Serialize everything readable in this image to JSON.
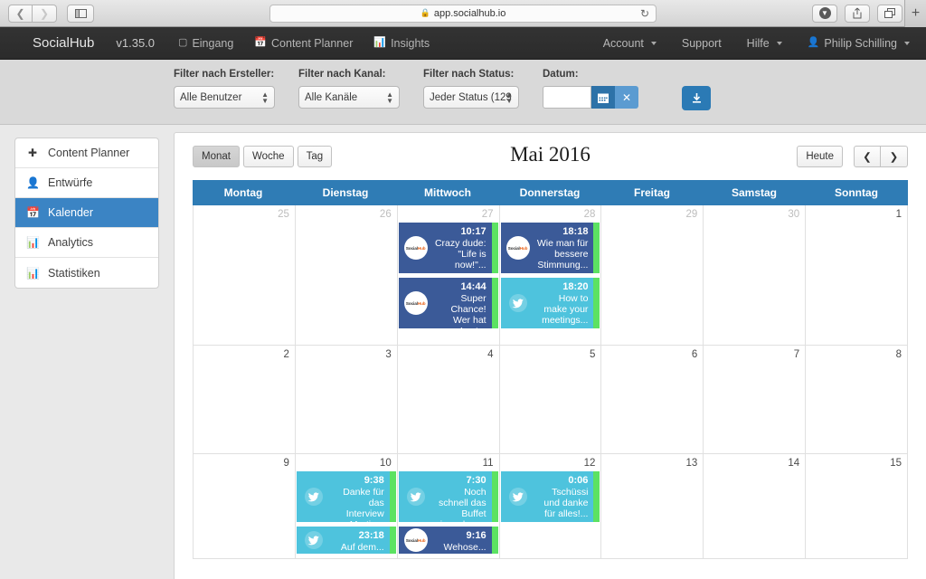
{
  "browser": {
    "url": "app.socialhub.io",
    "lock_icon": "lock-icon",
    "reload_icon": "reload-icon",
    "back_icon": "back-arrow-icon",
    "forward_icon": "forward-arrow-icon",
    "sidebar_icon": "sidebar-toggle-icon",
    "download_icon": "download-icon",
    "share_icon": "share-icon",
    "tabs_icon": "tabs-icon",
    "newtab_icon": "plus-icon"
  },
  "navbar": {
    "brand": "SocialHub",
    "version": "v1.35.0",
    "links": [
      {
        "label": "Eingang",
        "icon": "inbox-icon"
      },
      {
        "label": "Content Planner",
        "icon": "calendar-icon"
      },
      {
        "label": "Insights",
        "icon": "bar-chart-icon"
      }
    ],
    "right": [
      {
        "label": "Account",
        "caret": true
      },
      {
        "label": "Support",
        "caret": false
      },
      {
        "label": "Hilfe",
        "caret": true
      },
      {
        "label": "Philip Schilling",
        "caret": true,
        "icon": "user-icon"
      }
    ]
  },
  "filters": {
    "creator": {
      "label": "Filter nach Ersteller:",
      "value": "Alle Benutzer"
    },
    "channel": {
      "label": "Filter nach Kanal:",
      "value": "Alle Kanäle"
    },
    "status": {
      "label": "Filter nach Status:",
      "value": "Jeder Status (129"
    },
    "date": {
      "label": "Datum:",
      "value": "",
      "placeholder": ""
    },
    "calendar_button_icon": "calendar-icon",
    "clear_button_label": "✕",
    "export_button_icon": "download-icon"
  },
  "sidebar": {
    "items": [
      {
        "label": "Content Planner",
        "icon": "plus-icon",
        "active": false
      },
      {
        "label": "Entwürfe",
        "icon": "user-icon",
        "active": false
      },
      {
        "label": "Kalender",
        "icon": "calendar-icon",
        "active": true
      },
      {
        "label": "Analytics",
        "icon": "bar-chart-icon",
        "active": false
      },
      {
        "label": "Statistiken",
        "icon": "bar-chart-icon",
        "active": false
      }
    ]
  },
  "calendar": {
    "title": "Mai 2016",
    "views": [
      {
        "label": "Monat",
        "active": true
      },
      {
        "label": "Woche",
        "active": false
      },
      {
        "label": "Tag",
        "active": false
      }
    ],
    "today_label": "Heute",
    "prev_icon": "chevron-left-icon",
    "next_icon": "chevron-right-icon",
    "weekdays": [
      "Montag",
      "Dienstag",
      "Mittwoch",
      "Donnerstag",
      "Freitag",
      "Samstag",
      "Sonntag"
    ],
    "colors": {
      "header_blue": "#2f7cb5",
      "facebook_event": "#3b5a98",
      "twitter_event": "#4ec3dd",
      "status_strip_green": "#5ce262",
      "sidebar_active": "#3b84c4"
    },
    "weeks": [
      {
        "days": [
          {
            "num": "25",
            "muted": true,
            "events": []
          },
          {
            "num": "26",
            "muted": true,
            "events": []
          },
          {
            "num": "27",
            "muted": true,
            "events": [
              {
                "time": "10:17",
                "text": "Crazy dude: \"Life is now!\"...",
                "network": "fb",
                "avatar": "socialhub-logo"
              },
              {
                "time": "14:44",
                "text": "Super Chance! Wer hat Lust...",
                "network": "fb",
                "avatar": "socialhub-logo"
              }
            ]
          },
          {
            "num": "28",
            "muted": true,
            "events": [
              {
                "time": "18:18",
                "text": "Wie man für bessere Stimmung...",
                "network": "fb",
                "avatar": "socialhub-logo"
              },
              {
                "time": "18:20",
                "text": "How to make your meetings...",
                "network": "tw",
                "avatar": "twitter-bird"
              }
            ]
          },
          {
            "num": "29",
            "muted": true,
            "events": []
          },
          {
            "num": "30",
            "muted": true,
            "events": []
          },
          {
            "num": "1",
            "muted": false,
            "events": []
          }
        ]
      },
      {
        "days": [
          {
            "num": "2",
            "muted": false,
            "events": []
          },
          {
            "num": "3",
            "muted": false,
            "events": []
          },
          {
            "num": "4",
            "muted": false,
            "events": []
          },
          {
            "num": "5",
            "muted": false,
            "events": []
          },
          {
            "num": "6",
            "muted": false,
            "events": []
          },
          {
            "num": "7",
            "muted": false,
            "events": []
          },
          {
            "num": "8",
            "muted": false,
            "events": []
          }
        ]
      },
      {
        "days": [
          {
            "num": "9",
            "muted": false,
            "events": []
          },
          {
            "num": "10",
            "muted": false,
            "events": [
              {
                "time": "9:38",
                "text": "Danke für das Interview Martin...",
                "network": "tw",
                "avatar": "twitter-bird"
              },
              {
                "time": "23:18",
                "text": "Auf dem...",
                "network": "tw",
                "avatar": "twitter-bird",
                "cut": true
              }
            ]
          },
          {
            "num": "11",
            "muted": false,
            "events": [
              {
                "time": "7:30",
                "text": "Noch schnell das Buffet einpacken...",
                "network": "tw",
                "avatar": "twitter-bird"
              },
              {
                "time": "9:16",
                "text": "Wehose...",
                "network": "fb",
                "avatar": "socialhub-logo",
                "cut": true
              }
            ]
          },
          {
            "num": "12",
            "muted": false,
            "events": [
              {
                "time": "0:06",
                "text": "Tschüssi und danke für alles!...",
                "network": "tw",
                "avatar": "twitter-bird"
              }
            ]
          },
          {
            "num": "13",
            "muted": false,
            "events": []
          },
          {
            "num": "14",
            "muted": false,
            "events": []
          },
          {
            "num": "15",
            "muted": false,
            "events": []
          }
        ]
      }
    ]
  }
}
